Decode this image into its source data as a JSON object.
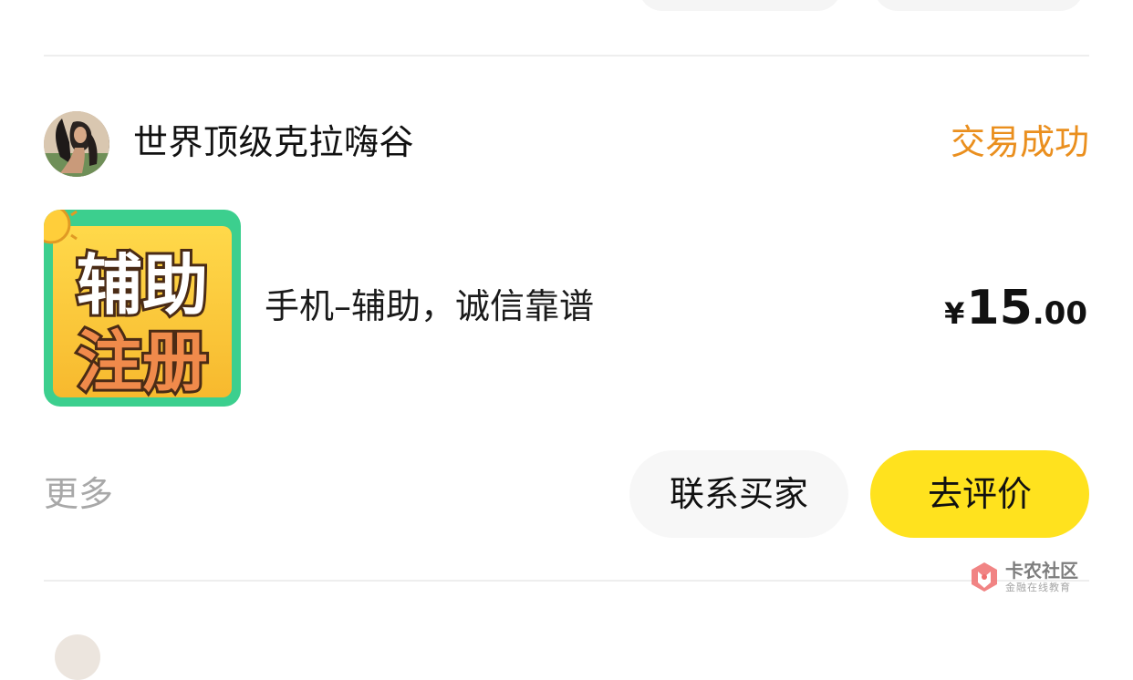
{
  "order": {
    "seller_name": "世界顶级克拉嗨谷",
    "status": "交易成功",
    "status_color": "#ea8f1e",
    "thumbnail": {
      "icon": "product-thumbnail",
      "line1": "辅助",
      "line2": "注册"
    },
    "product_title": "手机–辅助，诚信靠谱",
    "price": {
      "currency": "¥",
      "integer": "15",
      "decimal": ".00"
    },
    "more_label": "更多",
    "contact_button": "联系买家",
    "review_button": "去评价",
    "review_button_color": "#ffe21e"
  },
  "watermark": {
    "title": "卡农社区",
    "subtitle": "金融在线教育"
  }
}
